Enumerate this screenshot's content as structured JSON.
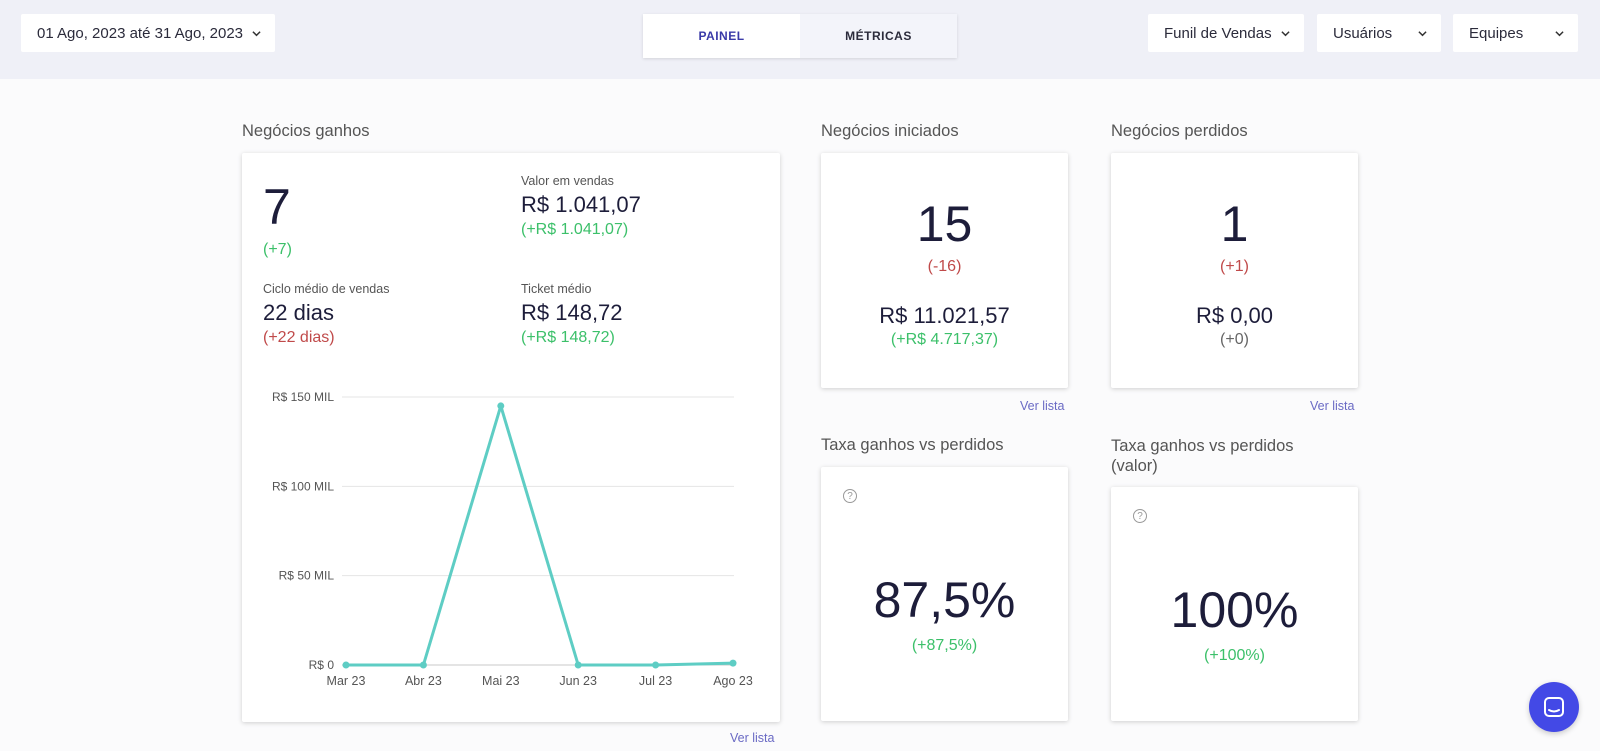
{
  "filters": {
    "date_range": "01 Ago, 2023 até 31 Ago, 2023",
    "pipeline": "Funil de Vendas",
    "users": "Usuários",
    "teams": "Equipes"
  },
  "tabs": [
    {
      "label": "PAINEL",
      "active": true
    },
    {
      "label": "MÉTRICAS",
      "active": false
    }
  ],
  "won": {
    "title": "Negócios ganhos",
    "count": "7",
    "count_delta": "(+7)",
    "sales_value_label": "Valor em vendas",
    "sales_value": "R$ 1.041,07",
    "sales_value_delta": "(+R$ 1.041,07)",
    "cycle_label": "Ciclo médio de vendas",
    "cycle_value": "22 dias",
    "cycle_delta": "(+22 dias)",
    "ticket_label": "Ticket médio",
    "ticket_value": "R$ 148,72",
    "ticket_delta": "(+R$ 148,72)",
    "link": "Ver lista"
  },
  "started": {
    "title": "Negócios iniciados",
    "count": "15",
    "count_delta": "(-16)",
    "value": "R$ 11.021,57",
    "value_delta": "(+R$ 4.717,37)",
    "link": "Ver lista"
  },
  "lost": {
    "title": "Negócios perdidos",
    "count": "1",
    "count_delta": "(+1)",
    "value": "R$ 0,00",
    "value_delta": "(+0)",
    "link": "Ver lista"
  },
  "rate": {
    "title": "Taxa ganhos vs perdidos",
    "value": "87,5%",
    "delta": "(+87,5%)",
    "help": "?"
  },
  "rate_value": {
    "title": "Taxa ganhos vs perdidos (valor)",
    "value": "100%",
    "delta": "(+100%)",
    "help": "?"
  },
  "colors": {
    "accent": "#3a3aa8",
    "line": "#5ecdc4",
    "positive": "#3cc06a",
    "negative": "#c04a4a",
    "chat": "#4349e6"
  },
  "chart_data": {
    "type": "line",
    "categories": [
      "Mar 23",
      "Abr 23",
      "Mai 23",
      "Jun 23",
      "Jul 23",
      "Ago 23"
    ],
    "values": [
      0,
      0,
      145000,
      0,
      0,
      1041.07
    ],
    "ylim": [
      0,
      150000
    ],
    "yticks": [
      0,
      50000,
      100000,
      150000
    ],
    "ytick_labels": [
      "R$ 0",
      "R$ 50 MIL",
      "R$ 100 MIL",
      "R$ 150 MIL"
    ],
    "grid": true,
    "title": "",
    "xlabel": "",
    "ylabel": ""
  }
}
